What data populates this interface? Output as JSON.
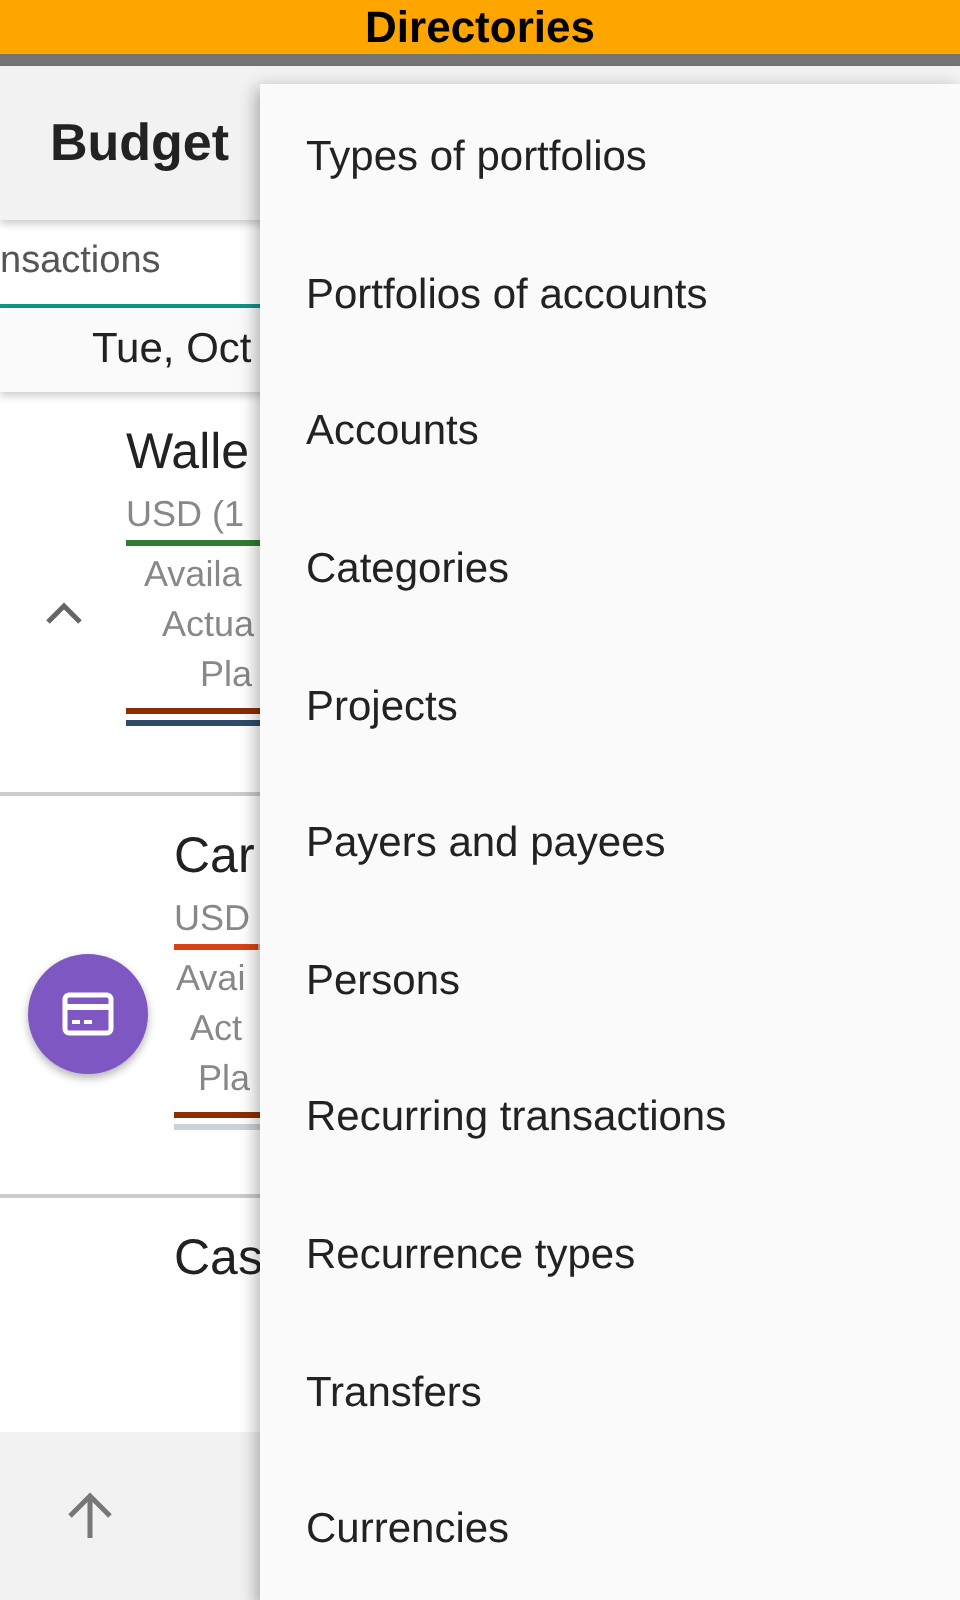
{
  "banner": {
    "title": "Directories"
  },
  "app_bar": {
    "title": "Budget"
  },
  "tab": {
    "label": "nsactions"
  },
  "date": {
    "label": "Tue, Oct"
  },
  "accounts": [
    {
      "kind": "expanded",
      "name": "Walle",
      "currency": "USD (1",
      "level": 1,
      "lines": [
        "Availa",
        "Actua",
        "Pla"
      ]
    },
    {
      "kind": "card",
      "name": "Car",
      "currency": "USD",
      "level": 0.6,
      "lines": [
        "Avai",
        "Act",
        "Pla"
      ]
    },
    {
      "kind": "plain",
      "name": "Cas"
    }
  ],
  "menu": {
    "items": [
      "Types of portfolios",
      "Portfolios of accounts",
      "Accounts",
      "Categories",
      "Projects",
      "Payers and payees",
      "Persons",
      "Recurring transactions",
      "Recurrence types",
      "Transfers",
      "Currencies"
    ]
  }
}
